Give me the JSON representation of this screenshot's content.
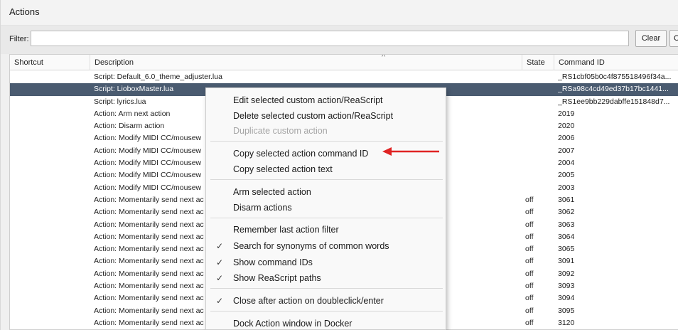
{
  "window": {
    "title": "Actions"
  },
  "filter": {
    "label": "Filter:",
    "value": "",
    "clear_label": "Clear",
    "close_label": "C"
  },
  "columns": {
    "shortcut": "Shortcut",
    "description": "Description",
    "state": "State",
    "command_id": "Command ID",
    "sort_caret": "^"
  },
  "rows": [
    {
      "description": "Script: Default_6.0_theme_adjuster.lua",
      "state": "",
      "command_id": "_RS1cbf05b0c4f875518496f34a..."
    },
    {
      "description": "Script: LioboxMaster.lua",
      "state": "",
      "command_id": "_RSa98c4cd49ed37b17bc1441..."
    },
    {
      "description": "Script: lyrics.lua",
      "state": "",
      "command_id": "_RS1ee9bb229dabffe151848d7..."
    },
    {
      "description": "Action: Arm next action",
      "state": "",
      "command_id": "2019"
    },
    {
      "description": "Action: Disarm action",
      "state": "",
      "command_id": "2020"
    },
    {
      "description": "Action: Modify MIDI CC/mousew",
      "state": "",
      "command_id": "2006"
    },
    {
      "description": "Action: Modify MIDI CC/mousew",
      "state": "",
      "command_id": "2007"
    },
    {
      "description": "Action: Modify MIDI CC/mousew",
      "state": "",
      "command_id": "2004"
    },
    {
      "description": "Action: Modify MIDI CC/mousew",
      "state": "",
      "command_id": "2005"
    },
    {
      "description": "Action: Modify MIDI CC/mousew",
      "state": "",
      "command_id": "2003"
    },
    {
      "description": "Action: Momentarily send next ac",
      "state": "off",
      "command_id": "3061"
    },
    {
      "description": "Action: Momentarily send next ac",
      "state": "off",
      "command_id": "3062"
    },
    {
      "description": "Action: Momentarily send next ac",
      "state": "off",
      "command_id": "3063"
    },
    {
      "description": "Action: Momentarily send next ac",
      "state": "off",
      "command_id": "3064"
    },
    {
      "description": "Action: Momentarily send next ac",
      "state": "off",
      "command_id": "3065"
    },
    {
      "description": "Action: Momentarily send next ac",
      "state": "off",
      "command_id": "3091"
    },
    {
      "description": "Action: Momentarily send next ac",
      "state": "off",
      "command_id": "3092"
    },
    {
      "description": "Action: Momentarily send next ac",
      "state": "off",
      "command_id": "3093"
    },
    {
      "description": "Action: Momentarily send next ac",
      "state": "off",
      "command_id": "3094"
    },
    {
      "description": "Action: Momentarily send next ac",
      "state": "off",
      "command_id": "3095"
    },
    {
      "description": "Action: Momentarily send next ac",
      "state": "off",
      "command_id": "3120"
    }
  ],
  "context_menu": {
    "items": [
      {
        "label": "Edit selected custom action/ReaScript",
        "checked": false,
        "disabled": false
      },
      {
        "label": "Delete selected custom action/ReaScript",
        "checked": false,
        "disabled": false
      },
      {
        "label": "Duplicate custom action",
        "checked": false,
        "disabled": true
      },
      {
        "label": "Copy selected action command ID",
        "checked": false,
        "disabled": false
      },
      {
        "label": "Copy selected action text",
        "checked": false,
        "disabled": false
      },
      {
        "label": "Arm selected action",
        "checked": false,
        "disabled": false
      },
      {
        "label": "Disarm actions",
        "checked": false,
        "disabled": false
      },
      {
        "label": "Remember last action filter",
        "checked": false,
        "disabled": false
      },
      {
        "label": "Search for synonyms of common words",
        "checked": true,
        "disabled": false
      },
      {
        "label": "Show command IDs",
        "checked": true,
        "disabled": false
      },
      {
        "label": "Show ReaScript paths",
        "checked": true,
        "disabled": false
      },
      {
        "label": "Close after action on doubleclick/enter",
        "checked": true,
        "disabled": false
      },
      {
        "label": "Dock Action window in Docker",
        "checked": false,
        "disabled": false
      }
    ],
    "check_glyph": "✓"
  },
  "colors": {
    "selection": "#4a5b70",
    "annotation_arrow": "#e02424"
  },
  "annotation": {
    "icon": "red-arrow-icon"
  }
}
